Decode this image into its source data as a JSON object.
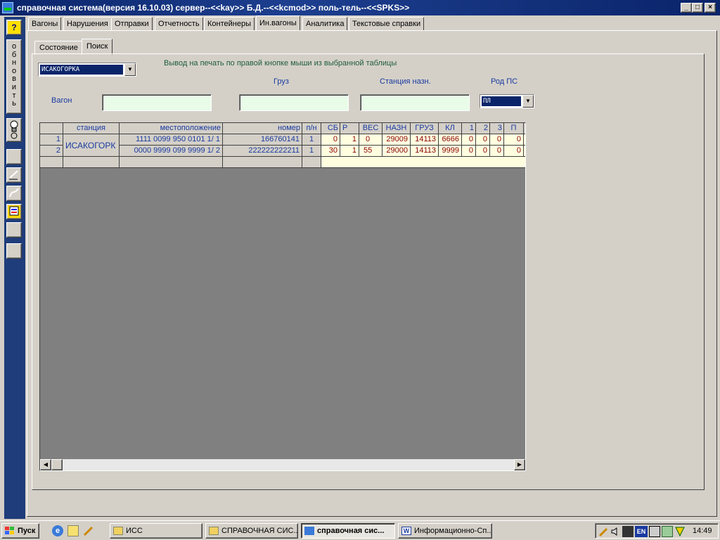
{
  "window": {
    "title": "справочная система(версия 16.10.03) сервер--<<kay>> Б.Д.--<<kcmod>> поль-тель--<<SPKS>>",
    "minimize": "_",
    "maximize": "□",
    "close": "×"
  },
  "left_toolbar": {
    "help": "?",
    "refresh_letters": [
      "о",
      "б",
      "н",
      "о",
      "в",
      "и",
      "т",
      "ь"
    ]
  },
  "main_tabs": [
    "Вагоны",
    "Нарушения",
    "Отправки",
    "Отчетность",
    "Контейнеры",
    "Ин.вагоны",
    "Аналитика",
    "Текстовые справки"
  ],
  "sub_tabs": [
    "Состояние",
    "Поиск"
  ],
  "form": {
    "station_combo": "ИСАКОГОРКА",
    "print_hint": "Вывод на печать по правой кнопке мыши из выбранной таблицы",
    "cargo_label": "Груз",
    "dest_label": "Станция назн.",
    "rodps_label": "Род ПС",
    "wagon_label": "Вагон",
    "rodps_value": "ПЛ"
  },
  "grid": {
    "headers": [
      "станция",
      "местоположение",
      "номер",
      "п/н",
      "СБ",
      "Р",
      "ВЕС",
      "НАЗН",
      "ГРУЗ",
      "КЛ",
      "1",
      "2",
      "3",
      "П"
    ],
    "rows": [
      {
        "num": "1",
        "loc": "1111 0099 950 0101  1/  1",
        "nomer": "166760141",
        "pn": "1",
        "sb": "0",
        "r": "1",
        "ves": "0",
        "nazn": "29009",
        "gruz": "14113",
        "kl": "6666",
        "c1": "0",
        "c2": "0",
        "c3": "0",
        "p": "0"
      },
      {
        "num": "2",
        "loc": "0000 9999 099 9999  1/  2",
        "nomer": "222222222211",
        "pn": "1",
        "sb": "30",
        "r": "1",
        "ves": "55",
        "nazn": "29000",
        "gruz": "14113",
        "kl": "9999",
        "c1": "0",
        "c2": "0",
        "c3": "0",
        "p": "0"
      }
    ],
    "merged_station": "ИСАКОГОРК"
  },
  "taskbar": {
    "start": "Пуск",
    "tasks": [
      "ИСС",
      "СПРАВОЧНАЯ СИС...",
      "справочная сис...",
      "Информационно-Сп..."
    ],
    "clock": "14:49",
    "lang": "EN"
  },
  "colors": {
    "title_bar": "#0a246a",
    "label_blue": "#1a3aa0",
    "data_red": "#8b0000",
    "input_green": "#e8fce8",
    "grid_yellow": "#ffffe0"
  }
}
